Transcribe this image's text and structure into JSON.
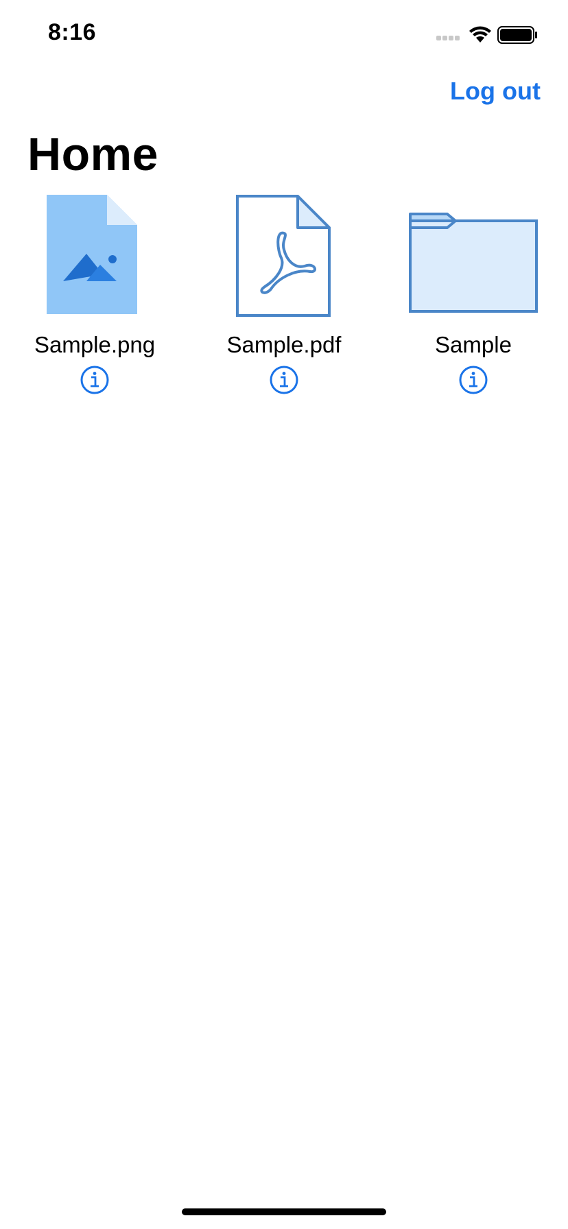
{
  "status_bar": {
    "time": "8:16",
    "icons": [
      "signal-icon",
      "wifi-icon",
      "battery-icon"
    ]
  },
  "nav": {
    "logout_label": "Log out",
    "title": "Home"
  },
  "items": [
    {
      "name": "Sample.png",
      "icon": "image-file-icon"
    },
    {
      "name": "Sample.pdf",
      "icon": "pdf-file-icon"
    },
    {
      "name": "Sample",
      "icon": "folder-icon"
    }
  ],
  "colors": {
    "accent": "#1a73e8",
    "icon_stroke": "#4a86c8",
    "icon_fill_light": "#dcecfc",
    "image_file_fill": "#90c6f7",
    "image_glyph": "#1f6dcc"
  }
}
